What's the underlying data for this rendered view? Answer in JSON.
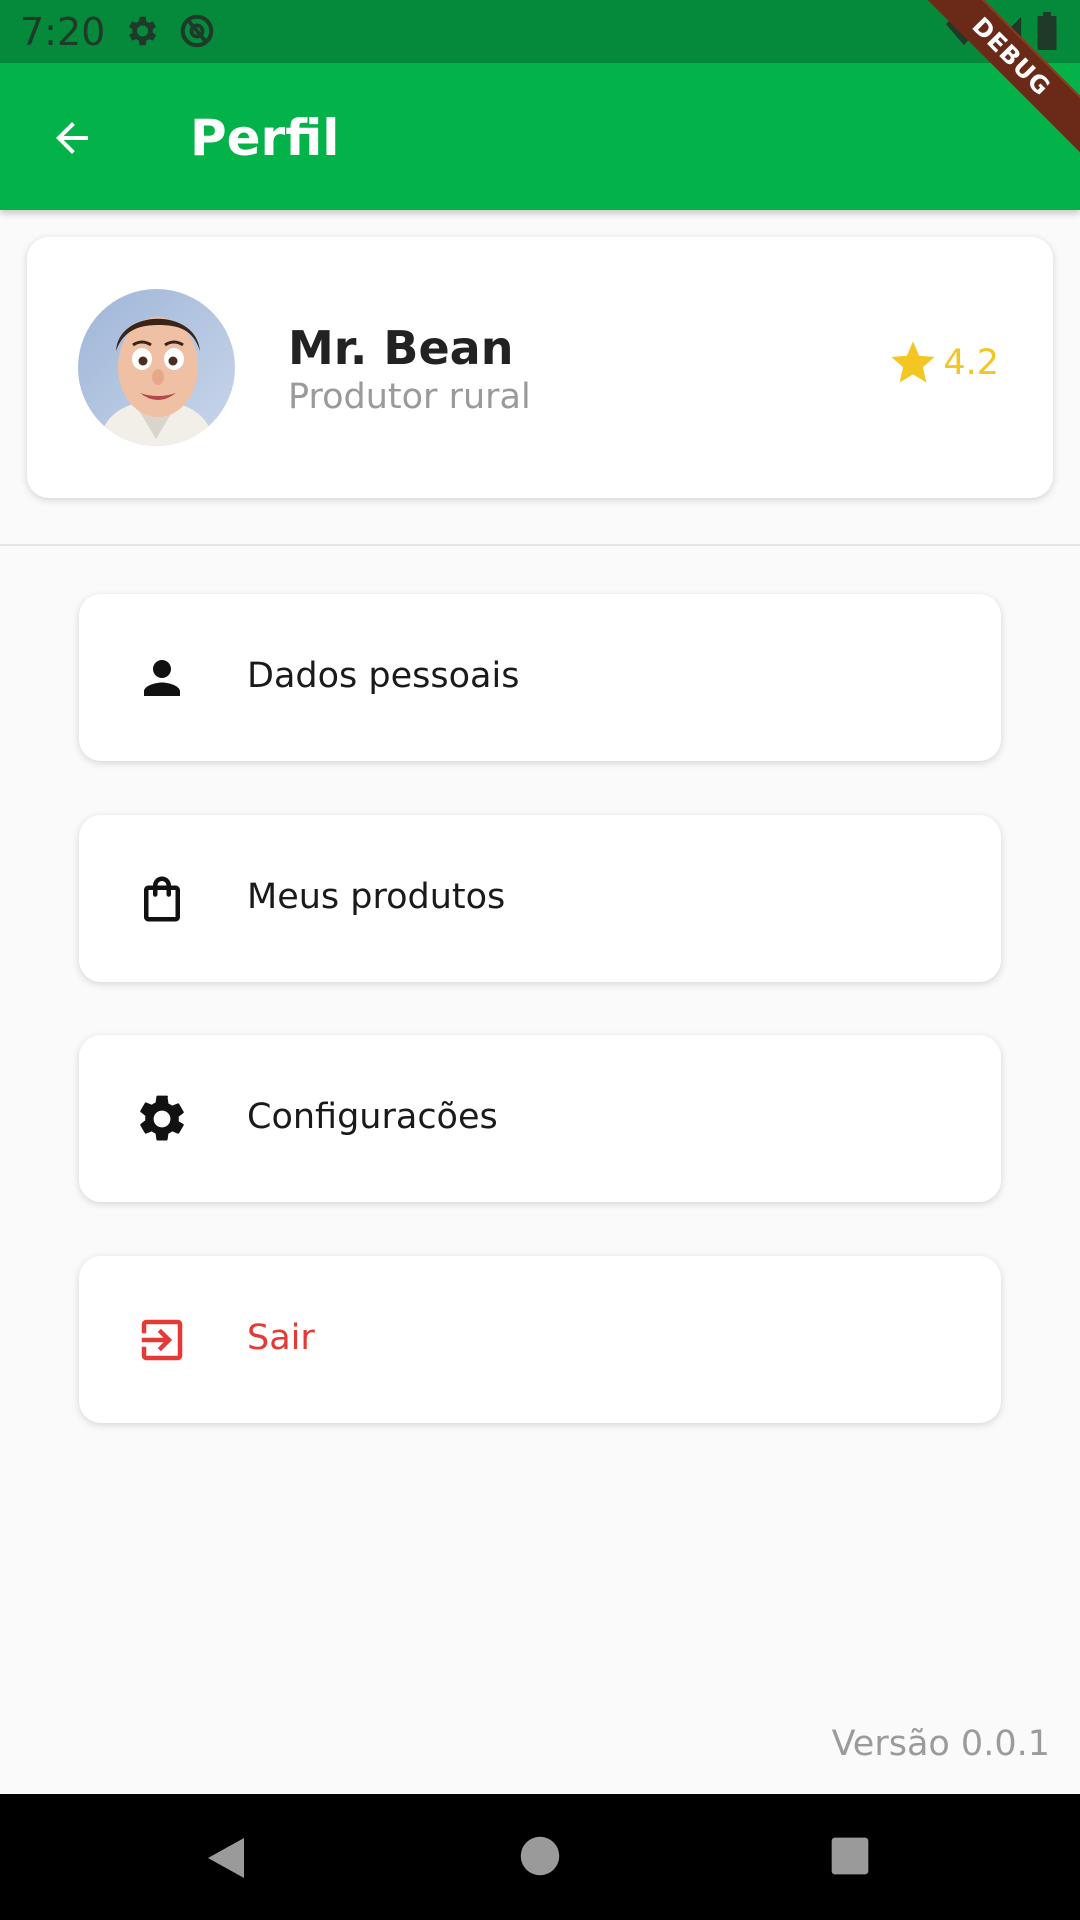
{
  "status_bar": {
    "time": "7:20",
    "left_icons": [
      "settings-icon",
      "at-sign-icon"
    ],
    "right_icons": [
      "wifi-icon",
      "signal-icon",
      "battery-icon"
    ],
    "background": "#058a3b"
  },
  "debug_banner": {
    "label": "DEBUG"
  },
  "app_bar": {
    "title": "Perfil",
    "back_icon": "arrow-back-icon",
    "background": "#03b34a"
  },
  "profile": {
    "name": "Mr. Bean",
    "role": "Produtor rural",
    "rating": "4.2",
    "rating_color": "#f4c623",
    "avatar_icon": "avatar-photo"
  },
  "menu": {
    "items": [
      {
        "label": "Dados pessoais",
        "icon": "person-icon",
        "color": "#1a1a1a"
      },
      {
        "label": "Meus produtos",
        "icon": "shopping-bag-icon",
        "color": "#1a1a1a"
      },
      {
        "label": "Configuracões",
        "icon": "gear-icon",
        "color": "#1a1a1a"
      },
      {
        "label": "Sair",
        "icon": "exit-icon",
        "color": "#e53935"
      }
    ]
  },
  "footer": {
    "version": "Versão 0.0.1"
  },
  "nav_bar": {
    "buttons": [
      "back-triangle-icon",
      "home-circle-icon",
      "recents-square-icon"
    ]
  }
}
